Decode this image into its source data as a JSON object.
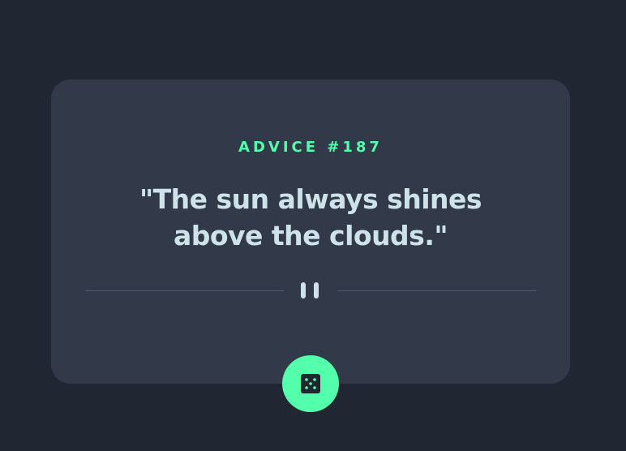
{
  "advice": {
    "label": "ADVICE #187",
    "text": "\"The sun always shines above the clouds.\""
  },
  "icons": {
    "divider": "pause-icon",
    "button": "dice-icon"
  },
  "colors": {
    "background": "#202632",
    "card": "#323a49",
    "accent": "#53ffaa",
    "text": "#cee3e9",
    "divider": "#4f5d74"
  }
}
